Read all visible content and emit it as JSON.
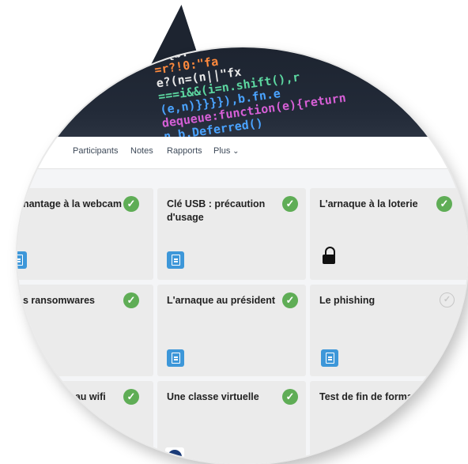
{
  "nav": {
    "items": [
      "Participants",
      "Notes",
      "Rapports",
      "Plus"
    ]
  },
  "code_banner": {
    "lines": [
      "(){b.",
      "=r?!0:\"fa",
      "e?(n=(n||\"fx",
      "===i&&(i=n.shift(),r",
      "(e,n)}}}}),b.fn.e",
      "dequeue:function(e){return",
      "n,b.Deferred()"
    ]
  },
  "cards": [
    {
      "title": "chantage à la webcam",
      "status": "done",
      "icon": "document-icon"
    },
    {
      "title": "Clé USB : précaution d'usage",
      "status": "done",
      "icon": "document-icon"
    },
    {
      "title": "L'arnaque à la loterie",
      "status": "done",
      "icon": "lock-icon"
    },
    {
      "title": "es ransomwares",
      "status": "done",
      "icon": "none"
    },
    {
      "title": "L'arnaque au président",
      "status": "done",
      "icon": "document-icon"
    },
    {
      "title": "Le phishing",
      "status": "pending",
      "icon": "document-icon"
    },
    {
      "title": "éseau wifi",
      "status": "done",
      "icon": "none"
    },
    {
      "title": "Une classe virtuelle",
      "status": "done",
      "icon": "zoom-icon"
    },
    {
      "title": "Test de fin de formati",
      "status": "none",
      "icon": "quiz-icon"
    }
  ],
  "colors": {
    "check_green": "#5fad56",
    "doc_blue": "#3d97d9",
    "quiz_pink": "#e0569d",
    "card_bg": "#ebebeb"
  }
}
